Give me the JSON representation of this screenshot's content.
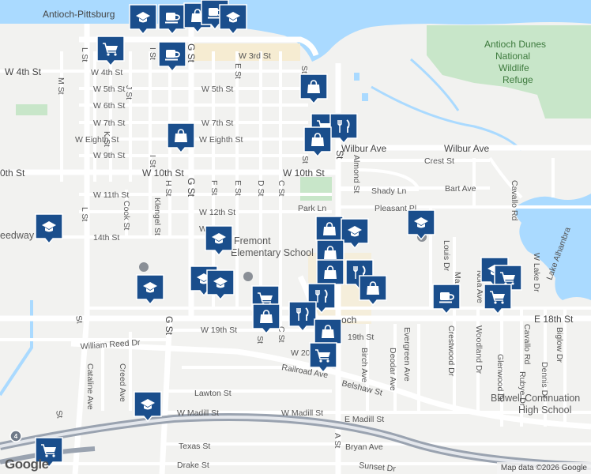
{
  "map": {
    "water_color": "#aadaff",
    "park_color": "#c8e6c9",
    "road_color": "#ffffff",
    "highway_color": "#9aa3b0",
    "marker_color": "#1a4e8c",
    "icons": [
      "school-icon",
      "coffee-icon",
      "shopping-bag-icon",
      "shopping-cart-icon",
      "restaurant-icon"
    ]
  },
  "labels": {
    "antioch_pittsburg": "Antioch-Pittsburg",
    "w_3rd": "W 3rd St",
    "w_4th": "W 4th St",
    "w_5th": "W 5th St",
    "w_5th_2": "W 5th St",
    "w_6th": "W 6th St",
    "w_7th": "W 7th St",
    "w_7th_2": "W 7th St",
    "w_eighth": "W Eighth St",
    "w_eighth_2": "W Eighth St",
    "w_9th": "W 9th St",
    "w_10th": "W 10th St",
    "w_10th_2": "W 10th St",
    "w_10th_edge": "0th St",
    "w_11th": "W 11th St",
    "w_12th": "W 12th St",
    "w_12th_stub": "W",
    "st_14th": "14th St",
    "w_19th": "W 19th St",
    "w_20th": "W 20",
    "e_18th": "E 18th St",
    "e_19th": "19th St",
    "wilbur_ave": "Wilbur Ave",
    "wilbur_ave_2": "Wilbur Ave",
    "crest_st": "Crest St",
    "bart_ave": "Bart Ave",
    "shady_ln": "Shady Ln",
    "park_ln": "Park Ln",
    "pleasant_pl": "Pleasant Pl",
    "almond_st": "Almond St",
    "l_st": "L St",
    "l_st_2": "L St",
    "m_st": "M St",
    "k_st": "K St",
    "j_st": "J St",
    "i_st": "I St",
    "h_st": "H St",
    "g_st": "G St",
    "g_st_2": "G St",
    "g_st_3": "G St",
    "f_st": "F St",
    "e_st": "E St",
    "e_st_2": "E St",
    "d_st": "D St",
    "c_st": "C St",
    "c_st_2": "C St",
    "a_st": "A St",
    "st_stub": "St",
    "st_stub_2": "St",
    "st_stub_3": "St",
    "st_stub_4": "St",
    "klengel_st": "Klengel St",
    "cook_st": "Cook St",
    "cavallo_rd": "Cavallo Rd",
    "cavallo_rd_2": "Cavallo Rd",
    "louis_dr": "Louis Dr",
    "ma": "Ma",
    "noia_ave": "Noia Ave",
    "w_lake_dr": "W Lake Dr",
    "lake_alhambra": "Lake Alhambra",
    "crestwood_dr": "Crestwood Dr",
    "woodland_dr": "Woodland Dr",
    "glenwood_dr": "Glenwood Dr",
    "biglow_dr": "Biglow Dr",
    "dennis_dr": "Dennis Dr",
    "rubye_dr": "Rubye Dr",
    "evergreen_ave": "Evergreen Ave",
    "deodar_ave": "Deodar Ave",
    "birch_ave": "Birch Ave",
    "william_reed": "William Reed Dr",
    "catalina_ave": "Cataline Ave",
    "creed_ave": "Creed Ave",
    "railroad_ave": "Railroad Ave",
    "belshaw_st": "Belshaw St",
    "lawton_st": "Lawton St",
    "w_madill": "W Madill St",
    "w_madill_2": "W Madill St",
    "e_madill": "E Madill St",
    "texas_st": "Texas St",
    "bryan_ave": "Bryan Ave",
    "drake_st": "Drake St",
    "sunset_dr": "Sunset Dr",
    "s_st": "St",
    "speedway": "eedway",
    "fremont": "Fremont",
    "fremont_2": "Elementary School",
    "bidwell": "Bidwell Continuation",
    "bidwell_2": "High School",
    "dunes_1": "Antioch Dunes",
    "dunes_2": "National",
    "dunes_3": "Wildlife",
    "dunes_4": "Refuge",
    "antioch_1": "Antioch",
    "antioch_2": "och",
    "shield_4": "4",
    "e_st_3": "E St"
  },
  "attribution": {
    "google_logo": "Google",
    "map_data": "Map data ©2026 Google"
  }
}
